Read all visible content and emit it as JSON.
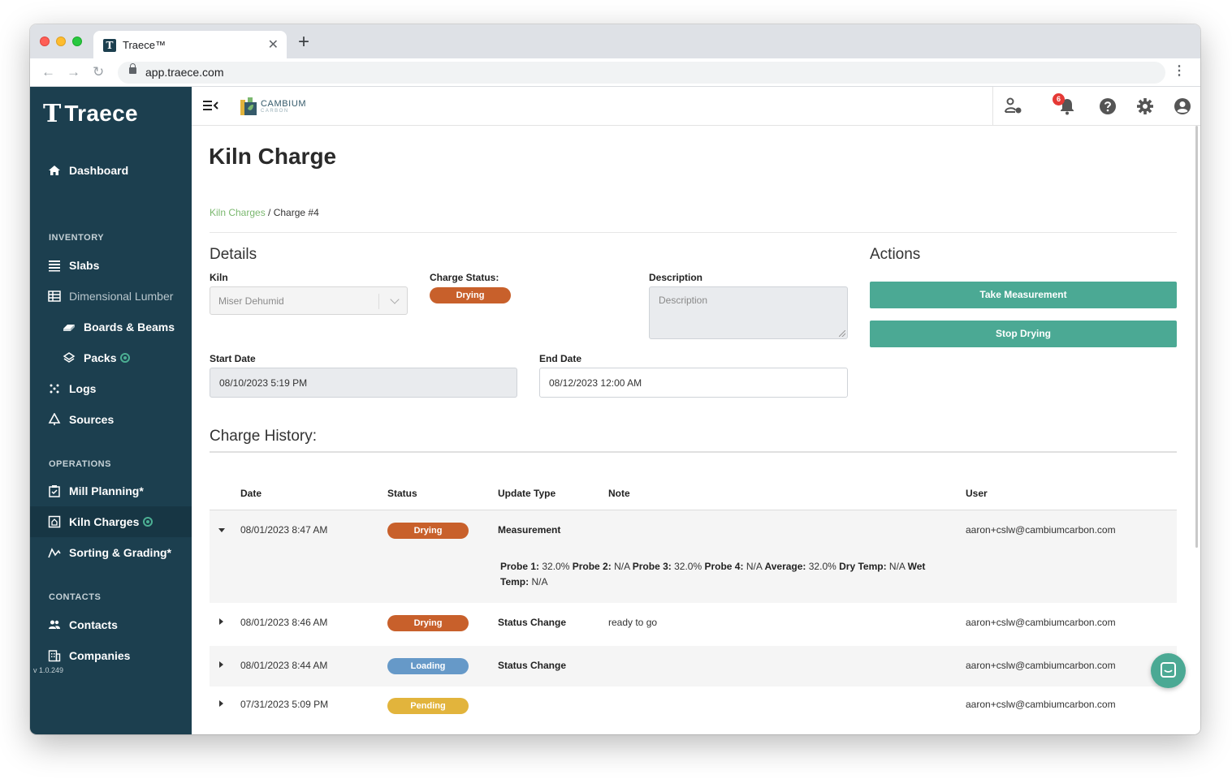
{
  "browser": {
    "tab_title": "Traece™",
    "url": "app.traece.com"
  },
  "sidebar": {
    "logo_text": "Traece",
    "dashboard": "Dashboard",
    "inventory_label": "INVENTORY",
    "slabs": "Slabs",
    "dimensional_lumber": "Dimensional Lumber",
    "boards_beams": "Boards & Beams",
    "packs": "Packs",
    "logs": "Logs",
    "sources": "Sources",
    "operations_label": "OPERATIONS",
    "mill_planning": "Mill Planning*",
    "kiln_charges": "Kiln Charges",
    "sorting_grading": "Sorting & Grading*",
    "contacts_label": "CONTACTS",
    "contacts": "Contacts",
    "companies": "Companies",
    "version": "v 1.0.249"
  },
  "appbar": {
    "brand_name": "CAMBIUM",
    "brand_sub": "CARBON",
    "notification_count": "6"
  },
  "page": {
    "title": "Kiln Charge",
    "breadcrumb_link": "Kiln Charges",
    "breadcrumb_sep": " / ",
    "breadcrumb_current": "Charge #4"
  },
  "details": {
    "title": "Details",
    "kiln_label": "Kiln",
    "kiln_value": "Miser Dehumid",
    "status_label": "Charge Status:",
    "status_value": "Drying",
    "description_label": "Description",
    "description_placeholder": "Description",
    "start_label": "Start Date",
    "start_value": "08/10/2023 5:19 PM",
    "end_label": "End Date",
    "end_value": "08/12/2023 12:00 AM"
  },
  "actions": {
    "title": "Actions",
    "take_measurement": "Take Measurement",
    "stop_drying": "Stop Drying"
  },
  "history": {
    "title": "Charge History:",
    "columns": [
      "Date",
      "Status",
      "Update Type",
      "Note",
      "User"
    ],
    "rows": [
      {
        "date": "08/01/2023 8:47 AM",
        "status": "Drying",
        "update_type": "Measurement",
        "note": "",
        "user": "aaron+cslw@cambiumcarbon.com",
        "expanded": true,
        "detail": {
          "probe1_label": "Probe 1:",
          "probe1": " 32.0% ",
          "probe2_label": "Probe 2:",
          "probe2": " N/A ",
          "probe3_label": "Probe 3:",
          "probe3": " 32.0% ",
          "probe4_label": "Probe 4:",
          "probe4": " N/A ",
          "average_label": "Average:",
          "average": " 32.0% ",
          "dry_label": "Dry Temp:",
          "dry": " N/A ",
          "wet_label": "Wet Temp:",
          "wet": " N/A"
        }
      },
      {
        "date": "08/01/2023 8:46 AM",
        "status": "Drying",
        "update_type": "Status Change",
        "note": "ready to go",
        "user": "aaron+cslw@cambiumcarbon.com",
        "expanded": false
      },
      {
        "date": "08/01/2023 8:44 AM",
        "status": "Loading",
        "update_type": "Status Change",
        "note": "",
        "user": "aaron+cslw@cambiumcarbon.com",
        "expanded": false
      },
      {
        "date": "07/31/2023 5:09 PM",
        "status": "Pending",
        "update_type": "",
        "note": "",
        "user": "aaron+cslw@cambiumcarbon.com",
        "expanded": false
      }
    ]
  },
  "colors": {
    "sidebar_bg": "#1c3f4f",
    "accent_green": "#4ba994",
    "drying": "#c8602b",
    "loading": "#6699c8",
    "pending": "#e2b43c",
    "link_green": "#7bb86f"
  }
}
